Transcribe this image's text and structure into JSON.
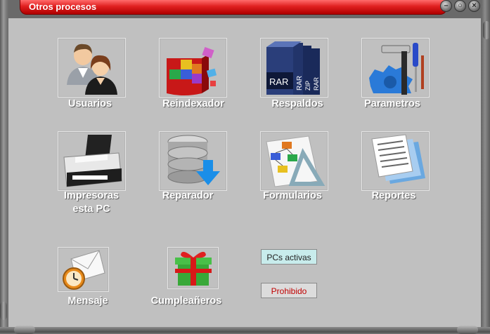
{
  "window": {
    "title": "Otros procesos"
  },
  "icons": {
    "usuarios": "Usuarios",
    "reindexador": "Reindexador",
    "respaldos": "Respaldos",
    "parametros": "Parametros",
    "impresoras_1": "Impresoras",
    "impresoras_2": "esta PC",
    "reparador": "Reparador",
    "formularios": "Formularios",
    "reportes": "Reportes",
    "mensaje": "Mensaje",
    "cumpleaneros": "Cumpleañeros"
  },
  "respaldos_art": {
    "rar1": "RAR",
    "rar2": "RAR",
    "zip": "ZIP",
    "rar3": "RAR"
  },
  "buttons": {
    "pcs_activas": "PCs activas",
    "prohibido": "Prohibido"
  },
  "colors": {
    "pcs_activas_bg": "#c8ecec",
    "prohibido_text": "#c00000",
    "title_bar": "#e02020"
  }
}
